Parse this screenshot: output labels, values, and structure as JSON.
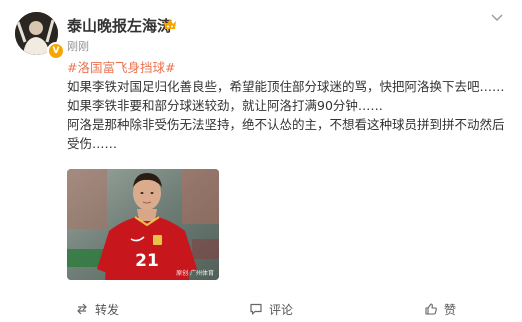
{
  "post": {
    "author": "泰山晚报左海涛",
    "time": "刚刚",
    "topic": "#洛国富飞身挡球#",
    "lines": [
      "如果李铁对国足归化善良些，希望能顶住部分球迷的骂，快把阿洛换下去吧……",
      "如果李铁非要和部分球迷较劲，就让阿洛打满90分钟……",
      "阿洛是那种除非受伤无法坚持，绝不认怂的主，不想看这种球员拼到拼不动然后受伤……"
    ],
    "image": {
      "jersey_number": "21",
      "watermark": "原创 广州体育"
    }
  },
  "actions": {
    "repost": "转发",
    "comment": "评论",
    "like": "赞"
  },
  "colors": {
    "topic": "#eb7350",
    "verified_badge": "#f7a600",
    "jersey": "#c8161d"
  },
  "icons": {
    "more": "chevron-down-icon",
    "repost": "repost-icon",
    "comment": "comment-icon",
    "like": "thumbs-up-icon"
  }
}
